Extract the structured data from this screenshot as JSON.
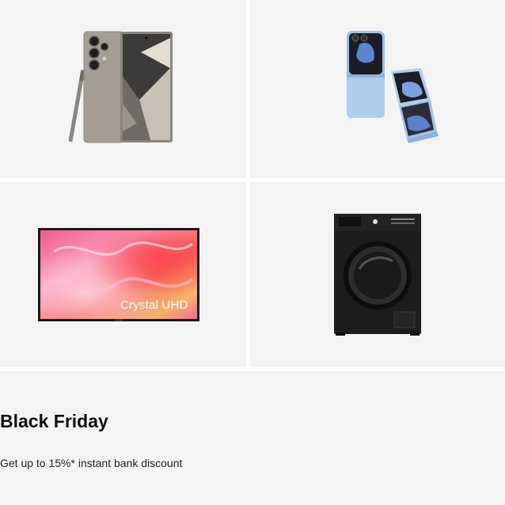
{
  "tiles": [
    {
      "id": "galaxy-s24-ultra",
      "icon": "smartphone-with-stylus-image"
    },
    {
      "id": "galaxy-z-flip6",
      "icon": "flip-phone-image"
    },
    {
      "id": "crystal-uhd-tv",
      "icon": "television-image",
      "screen_text": "Crystal UHD"
    },
    {
      "id": "washing-machine",
      "icon": "front-load-washer-image"
    }
  ],
  "promo": {
    "title": "Black Friday",
    "subtitle": "Get up to 15%* instant bank discount"
  },
  "colors": {
    "tile_bg": "#f4f4f4",
    "gap": "#ffffff",
    "text": "#111111"
  }
}
